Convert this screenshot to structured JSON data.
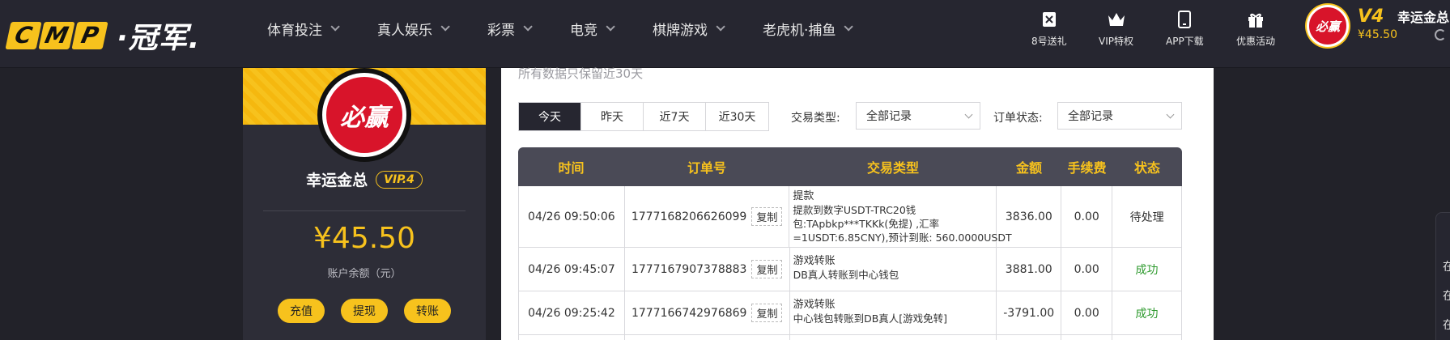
{
  "brand": {
    "cmp_letters": [
      "C",
      "M",
      "P"
    ],
    "name": "·冠军."
  },
  "nav": [
    {
      "label": "体育投注"
    },
    {
      "label": "真人娱乐"
    },
    {
      "label": "彩票"
    },
    {
      "label": "电竞"
    },
    {
      "label": "棋牌游戏"
    },
    {
      "label": "老虎机·捕鱼"
    }
  ],
  "quick_links": [
    {
      "label": "8号送礼",
      "icon": "gift-box-icon"
    },
    {
      "label": "VIP特权",
      "icon": "crown-icon"
    },
    {
      "label": "APP下载",
      "icon": "phone-icon"
    },
    {
      "label": "优惠活动",
      "icon": "present-icon"
    }
  ],
  "user": {
    "avatar_text": "必赢",
    "vip_badge": "V4",
    "balance_short": "¥45.50",
    "name": "幸运金总",
    "vip_label": "VIP.4",
    "balance": "¥45.50",
    "balance_label": "账户余额（元）"
  },
  "actions": {
    "deposit": "充值",
    "withdraw": "提现",
    "transfer": "转账"
  },
  "records": {
    "note": "所有数据只保留近30天",
    "date_tabs": [
      "今天",
      "昨天",
      "近7天",
      "近30天"
    ],
    "active_tab": "今天",
    "type_label": "交易类型:",
    "type_value": "全部记录",
    "status_label": "订单状态:",
    "status_value": "全部记录",
    "columns": [
      "时间",
      "订单号",
      "交易类型",
      "金额",
      "手续费",
      "状态"
    ],
    "copy_label": "复制",
    "rows": [
      {
        "time": "04/26 09:50:06",
        "order": "1777168206626099",
        "type_title": "提款",
        "type_detail": [
          "提款到数字USDT-TRC20钱",
          "包:TApbkp***TKKk(免提) ,汇率",
          "=1USDT:6.85CNY),预计到账:  560.0000USDT"
        ],
        "amount": "3836.00",
        "fee": "0.00",
        "status": "待处理"
      },
      {
        "time": "04/26 09:45:07",
        "order": "1777167907378883",
        "type_title": "游戏转账",
        "type_detail": [
          "DB真人转账到中心钱包"
        ],
        "amount": "3881.00",
        "fee": "0.00",
        "status": "成功"
      },
      {
        "time": "04/26 09:25:42",
        "order": "1777166742976869",
        "type_title": "游戏转账",
        "type_detail": [
          "中心钱包转账到DB真人[游戏免转]"
        ],
        "amount": "-3791.00",
        "fee": "0.00",
        "status": "成功"
      }
    ]
  },
  "edge_widget": {
    "chars": [
      "在",
      "在",
      "在"
    ]
  },
  "colors": {
    "accent": "#f7c21d",
    "topbar": "#262630",
    "success": "#2e9a2e",
    "brand_red": "#d8142a"
  }
}
